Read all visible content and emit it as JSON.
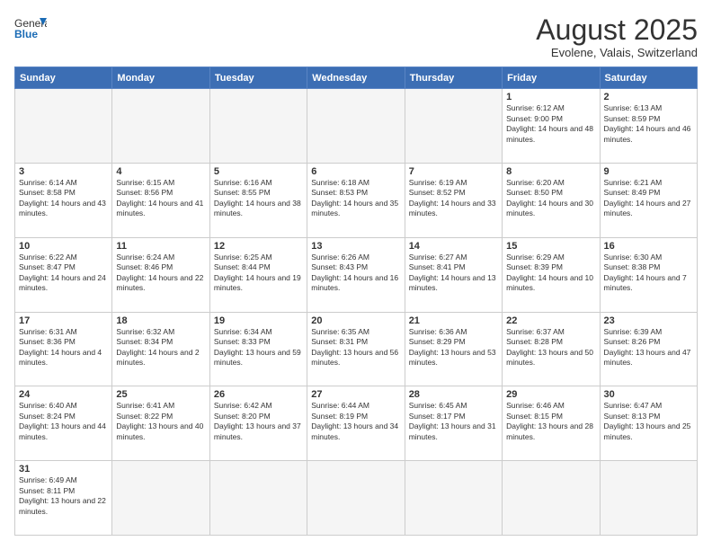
{
  "logo": {
    "general": "General",
    "blue": "Blue"
  },
  "title": "August 2025",
  "subtitle": "Evolene, Valais, Switzerland",
  "days_of_week": [
    "Sunday",
    "Monday",
    "Tuesday",
    "Wednesday",
    "Thursday",
    "Friday",
    "Saturday"
  ],
  "weeks": [
    [
      {
        "day": "",
        "empty": true
      },
      {
        "day": "",
        "empty": true
      },
      {
        "day": "",
        "empty": true
      },
      {
        "day": "",
        "empty": true
      },
      {
        "day": "",
        "empty": true
      },
      {
        "day": "1",
        "sunrise": "6:12 AM",
        "sunset": "9:00 PM",
        "daylight": "14 hours and 48 minutes."
      },
      {
        "day": "2",
        "sunrise": "6:13 AM",
        "sunset": "8:59 PM",
        "daylight": "14 hours and 46 minutes."
      }
    ],
    [
      {
        "day": "3",
        "sunrise": "6:14 AM",
        "sunset": "8:58 PM",
        "daylight": "14 hours and 43 minutes."
      },
      {
        "day": "4",
        "sunrise": "6:15 AM",
        "sunset": "8:56 PM",
        "daylight": "14 hours and 41 minutes."
      },
      {
        "day": "5",
        "sunrise": "6:16 AM",
        "sunset": "8:55 PM",
        "daylight": "14 hours and 38 minutes."
      },
      {
        "day": "6",
        "sunrise": "6:18 AM",
        "sunset": "8:53 PM",
        "daylight": "14 hours and 35 minutes."
      },
      {
        "day": "7",
        "sunrise": "6:19 AM",
        "sunset": "8:52 PM",
        "daylight": "14 hours and 33 minutes."
      },
      {
        "day": "8",
        "sunrise": "6:20 AM",
        "sunset": "8:50 PM",
        "daylight": "14 hours and 30 minutes."
      },
      {
        "day": "9",
        "sunrise": "6:21 AM",
        "sunset": "8:49 PM",
        "daylight": "14 hours and 27 minutes."
      }
    ],
    [
      {
        "day": "10",
        "sunrise": "6:22 AM",
        "sunset": "8:47 PM",
        "daylight": "14 hours and 24 minutes."
      },
      {
        "day": "11",
        "sunrise": "6:24 AM",
        "sunset": "8:46 PM",
        "daylight": "14 hours and 22 minutes."
      },
      {
        "day": "12",
        "sunrise": "6:25 AM",
        "sunset": "8:44 PM",
        "daylight": "14 hours and 19 minutes."
      },
      {
        "day": "13",
        "sunrise": "6:26 AM",
        "sunset": "8:43 PM",
        "daylight": "14 hours and 16 minutes."
      },
      {
        "day": "14",
        "sunrise": "6:27 AM",
        "sunset": "8:41 PM",
        "daylight": "14 hours and 13 minutes."
      },
      {
        "day": "15",
        "sunrise": "6:29 AM",
        "sunset": "8:39 PM",
        "daylight": "14 hours and 10 minutes."
      },
      {
        "day": "16",
        "sunrise": "6:30 AM",
        "sunset": "8:38 PM",
        "daylight": "14 hours and 7 minutes."
      }
    ],
    [
      {
        "day": "17",
        "sunrise": "6:31 AM",
        "sunset": "8:36 PM",
        "daylight": "14 hours and 4 minutes."
      },
      {
        "day": "18",
        "sunrise": "6:32 AM",
        "sunset": "8:34 PM",
        "daylight": "14 hours and 2 minutes."
      },
      {
        "day": "19",
        "sunrise": "6:34 AM",
        "sunset": "8:33 PM",
        "daylight": "13 hours and 59 minutes."
      },
      {
        "day": "20",
        "sunrise": "6:35 AM",
        "sunset": "8:31 PM",
        "daylight": "13 hours and 56 minutes."
      },
      {
        "day": "21",
        "sunrise": "6:36 AM",
        "sunset": "8:29 PM",
        "daylight": "13 hours and 53 minutes."
      },
      {
        "day": "22",
        "sunrise": "6:37 AM",
        "sunset": "8:28 PM",
        "daylight": "13 hours and 50 minutes."
      },
      {
        "day": "23",
        "sunrise": "6:39 AM",
        "sunset": "8:26 PM",
        "daylight": "13 hours and 47 minutes."
      }
    ],
    [
      {
        "day": "24",
        "sunrise": "6:40 AM",
        "sunset": "8:24 PM",
        "daylight": "13 hours and 44 minutes."
      },
      {
        "day": "25",
        "sunrise": "6:41 AM",
        "sunset": "8:22 PM",
        "daylight": "13 hours and 40 minutes."
      },
      {
        "day": "26",
        "sunrise": "6:42 AM",
        "sunset": "8:20 PM",
        "daylight": "13 hours and 37 minutes."
      },
      {
        "day": "27",
        "sunrise": "6:44 AM",
        "sunset": "8:19 PM",
        "daylight": "13 hours and 34 minutes."
      },
      {
        "day": "28",
        "sunrise": "6:45 AM",
        "sunset": "8:17 PM",
        "daylight": "13 hours and 31 minutes."
      },
      {
        "day": "29",
        "sunrise": "6:46 AM",
        "sunset": "8:15 PM",
        "daylight": "13 hours and 28 minutes."
      },
      {
        "day": "30",
        "sunrise": "6:47 AM",
        "sunset": "8:13 PM",
        "daylight": "13 hours and 25 minutes."
      }
    ],
    [
      {
        "day": "31",
        "sunrise": "6:49 AM",
        "sunset": "8:11 PM",
        "daylight": "13 hours and 22 minutes."
      },
      {
        "day": "",
        "empty": true
      },
      {
        "day": "",
        "empty": true
      },
      {
        "day": "",
        "empty": true
      },
      {
        "day": "",
        "empty": true
      },
      {
        "day": "",
        "empty": true
      },
      {
        "day": "",
        "empty": true
      }
    ]
  ],
  "colors": {
    "header_bg": "#3c6eb4",
    "header_text": "#ffffff",
    "border": "#cccccc",
    "empty_bg": "#f5f5f5"
  }
}
